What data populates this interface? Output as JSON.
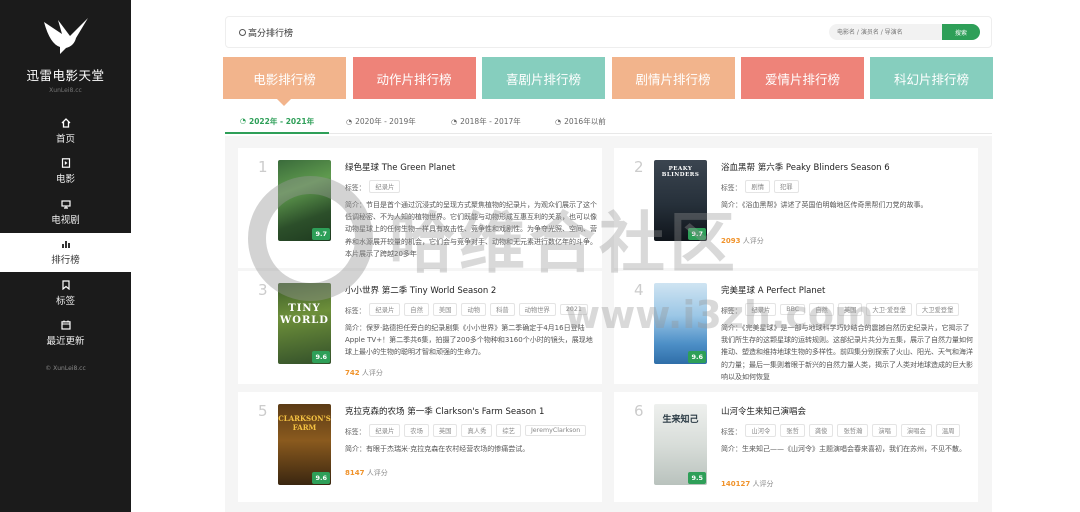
{
  "sidebar": {
    "site_name": "迅雷电影天堂",
    "site_sub": "XunLei8.cc",
    "nav": [
      {
        "label": "首页",
        "icon": "home-icon",
        "active": false
      },
      {
        "label": "电影",
        "icon": "film-icon",
        "active": false
      },
      {
        "label": "电视剧",
        "icon": "tv-icon",
        "active": false
      },
      {
        "label": "排行榜",
        "icon": "ranking-icon",
        "active": true
      },
      {
        "label": "标签",
        "icon": "bookmark-icon",
        "active": false
      },
      {
        "label": "最近更新",
        "icon": "calendar-icon",
        "active": false
      }
    ],
    "copyright": "© XunLei8.cc"
  },
  "topbar": {
    "title": "高分排行榜",
    "search_placeholder": "电影名 / 演员名 / 导演名",
    "search_button": "搜索"
  },
  "categories": [
    {
      "label": "电影排行榜",
      "color": "#f2b48c"
    },
    {
      "label": "动作片排行榜",
      "color": "#ee8379"
    },
    {
      "label": "喜剧片排行榜",
      "color": "#86cebe"
    },
    {
      "label": "剧情片排行榜",
      "color": "#f2b48c"
    },
    {
      "label": "爱情片排行榜",
      "color": "#ee8379"
    },
    {
      "label": "科幻片排行榜",
      "color": "#86cebe"
    }
  ],
  "tabs": [
    {
      "label": "2022年 - 2021年",
      "active": true
    },
    {
      "label": "2020年 - 2019年",
      "active": false
    },
    {
      "label": "2018年 - 2017年",
      "active": false
    },
    {
      "label": "2016年以前",
      "active": false
    }
  ],
  "tags_label": "标签：",
  "desc_label": "简介：",
  "raters_suffix": "人评分",
  "items": [
    {
      "rank": "1",
      "title": "绿色星球 The Green Planet",
      "tags": [
        "纪录片"
      ],
      "desc": "节目是首个通过沉浸式的呈现方式聚焦植物的纪录片，为观众们展示了这个低调秘密、不为人知的植物世界。它们既能与动物形成互惠互利的关系，也可以像动物星球上的任何生物一样具有攻击性、竞争性和戏剧性。为争夺光照、空间、营养和水源展开较量的机会，它们会与竞争对手、动物和无元素进行数亿年的斗争。本片展示了跨越20多年",
      "score": "9.7",
      "raters": "",
      "poster_bg": "linear-gradient(160deg,#3a6b3b 0%,#5f9a4e 35%,#2c4f2a 70%,#1e3a1f 100%)",
      "poster_text": ""
    },
    {
      "rank": "2",
      "title": "浴血黑帮 第六季 Peaky Blinders Season 6",
      "tags": [
        "剧情",
        "犯罪"
      ],
      "desc": "《浴血黑帮》讲述了英国伯明翰地区传奇黑帮们刀党的故事。",
      "score": "9.7",
      "raters": "2093",
      "poster_bg": "linear-gradient(180deg,#3b4550 0%,#26303a 55%,#0f141a 100%)",
      "poster_text": "PEAKY BLINDERS"
    },
    {
      "rank": "3",
      "title": "小小世界 第二季 Tiny World Season 2",
      "tags": [
        "纪录片",
        "自然",
        "美国",
        "动物",
        "科普",
        "动物世界",
        "2021"
      ],
      "desc": "保罗·路德担任旁白的纪录剧集《小小世界》第二季确定于4月16日登陆Apple TV+！第二季共6集，拍摄了200多个物种和3160个小时的镜头，展现地球上最小的生物的聪明才智和顽强的生命力。",
      "score": "9.6",
      "raters": "742",
      "poster_bg": "linear-gradient(170deg,#3e5f2a 0%,#6d8f3a 40%,#33502a 100%)",
      "poster_text": "TINY WORLD"
    },
    {
      "rank": "4",
      "title": "完美星球 A Perfect Planet",
      "tags": [
        "纪录片",
        "BBC",
        "自然",
        "英国",
        "大卫·爱登堡",
        "大卫爱登堡"
      ],
      "desc": "《完美星球》是一部与地球科学巧妙结合的震撼自然历史纪录片，它揭示了我们所生存的这颗星球的运转规则。这部纪录片共分为五集，展示了自然力量如何推动、塑造和维持地球生物的多样性。前四集分别探索了火山、阳光、天气和海洋的力量；最后一集则着眼于新兴的自然力量人类，揭示了人类对地球造成的巨大影响以及如何恢复",
      "score": "9.6",
      "raters": "",
      "poster_bg": "linear-gradient(180deg,#cfe4f2 0%,#9cc7e6 40%,#4d8fc7 75%,#2f6ea8 100%)",
      "poster_text": ""
    },
    {
      "rank": "5",
      "title": "克拉克森的农场 第一季 Clarkson's Farm Season 1",
      "tags": [
        "纪录片",
        "农场",
        "英国",
        "真人秀",
        "综艺",
        "JeremyClarkson"
      ],
      "desc": "有眼于杰瑞米·克拉克森在农村经营农场的惨痛尝试。",
      "score": "9.6",
      "raters": "8147",
      "poster_bg": "linear-gradient(180deg,#5b3b16 0%,#8a5a1e 45%,#3a2610 100%)",
      "poster_text": "CLARKSON'S FARM"
    },
    {
      "rank": "6",
      "title": "山河令生来知己演唱会",
      "tags": [
        "山河令",
        "张哲",
        "龚俊",
        "张哲瀚",
        "演唱",
        "演唱会",
        "温周"
      ],
      "desc": "生来知己——《山河令》主题演唱会春来喜初，我们在苏州，不见不散。",
      "score": "9.5",
      "raters": "140127",
      "poster_bg": "linear-gradient(180deg,#eef0ee 0%,#d8ddd9 50%,#b9c2bd 100%)",
      "poster_text": "生来知己"
    }
  ],
  "watermark": {
    "main": "哈维合社区",
    "url": "www.i3zh.com"
  }
}
